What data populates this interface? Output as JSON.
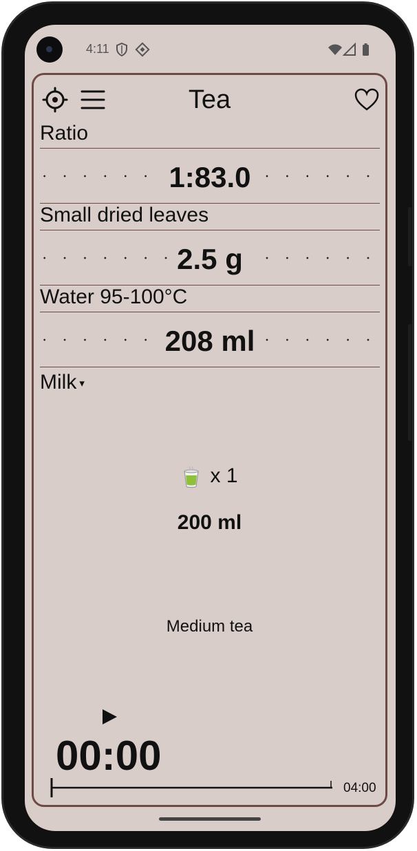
{
  "status_bar": {
    "time": "4:11"
  },
  "toolbar": {
    "title": "Tea",
    "icons": [
      "settings-icon",
      "menu-icon",
      "favorite-icon"
    ]
  },
  "ratio": {
    "label": "Ratio",
    "value": "1:83.0"
  },
  "leaves": {
    "label": "Small dried leaves",
    "value": "2.5 g"
  },
  "water": {
    "label": "Water 95-100°C",
    "value": "208 ml"
  },
  "milk": {
    "label": "Milk",
    "caret": "▾"
  },
  "serving": {
    "cup_icon": "tea-cup-icon",
    "count": "x 1",
    "volume": "200 ml",
    "strength": "Medium tea"
  },
  "timer": {
    "play_icon": "play-icon",
    "elapsed": "00:00",
    "end": "04:00"
  },
  "colors": {
    "background": "#d9cdca",
    "accent": "#6e4a44"
  }
}
